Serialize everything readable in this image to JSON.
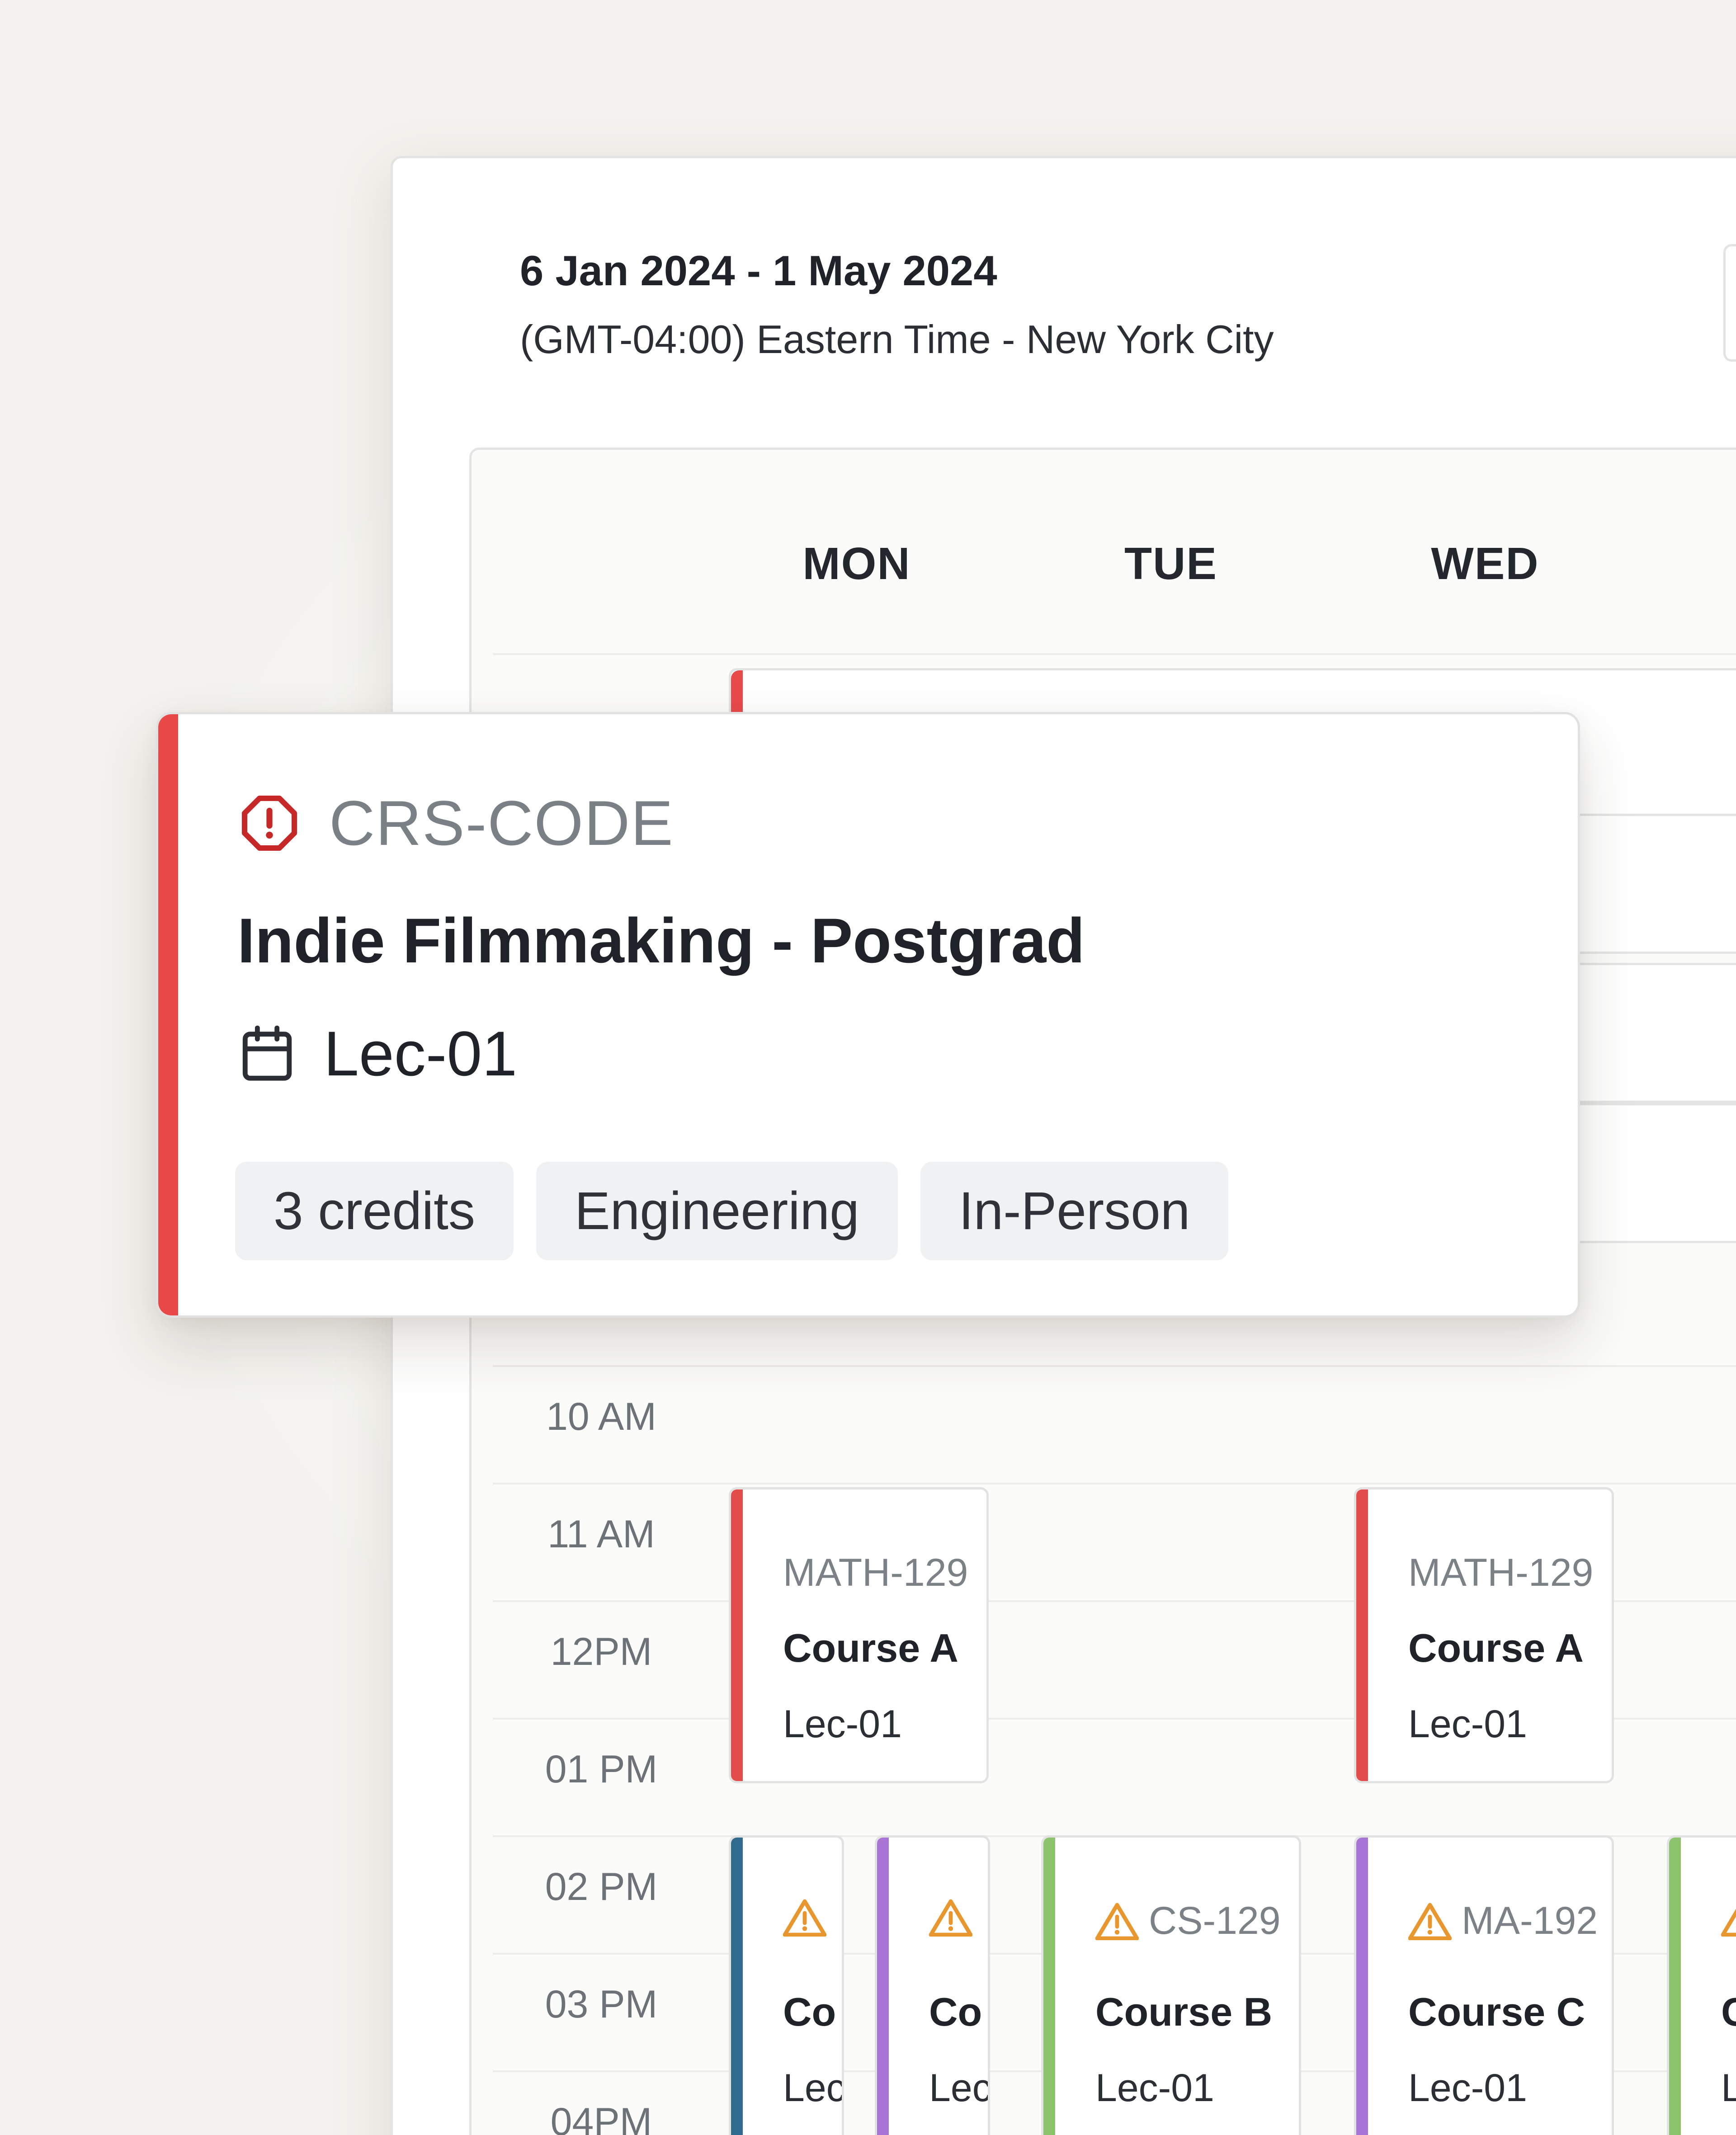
{
  "header": {
    "date_range": "6 Jan 2024 - 1 May 2024",
    "timezone": "(GMT-04:00) Eastern Time - New York City"
  },
  "calendar": {
    "days": [
      "MON",
      "TUE",
      "WED"
    ],
    "times": [
      "10 AM",
      "11 AM",
      "12PM",
      "01 PM",
      "02 PM",
      "03 PM",
      "04PM"
    ],
    "events": [
      {
        "code": "MATH-129",
        "name": "Course A",
        "section": "Lec-01",
        "color": "#e24c4b",
        "warning": false
      },
      {
        "code": "MATH-129",
        "name": "Course A",
        "section": "Lec-01",
        "color": "#e24c4b",
        "warning": false
      },
      {
        "code": "",
        "name": "Co",
        "section": "Lec",
        "color": "#2e6b8f",
        "warning": true
      },
      {
        "code": "",
        "name": "Co",
        "section": "Lec",
        "color": "#a875d6",
        "warning": true
      },
      {
        "code": "CS-129",
        "name": "Course B",
        "section": "Lec-01",
        "color": "#8cc46e",
        "warning": true
      },
      {
        "code": "MA-192",
        "name": "Course C",
        "section": "Lec-01",
        "color": "#a875d6",
        "warning": true
      },
      {
        "code": "",
        "name": "C",
        "section": "L",
        "color": "#8cc46e",
        "warning": true
      }
    ]
  },
  "popover": {
    "code": "CRS-CODE",
    "title": "Indie Filmmaking - Postgrad",
    "section": "Lec-01",
    "chips": [
      "3 credits",
      "Engineering",
      "In-Person"
    ],
    "accent_color": "#e94848",
    "alert_icon": "alert-octagon-icon",
    "section_icon": "calendar-icon"
  },
  "colors": {
    "background": "#f3f2ee",
    "warning": "#e8962e",
    "error": "#c62828"
  }
}
